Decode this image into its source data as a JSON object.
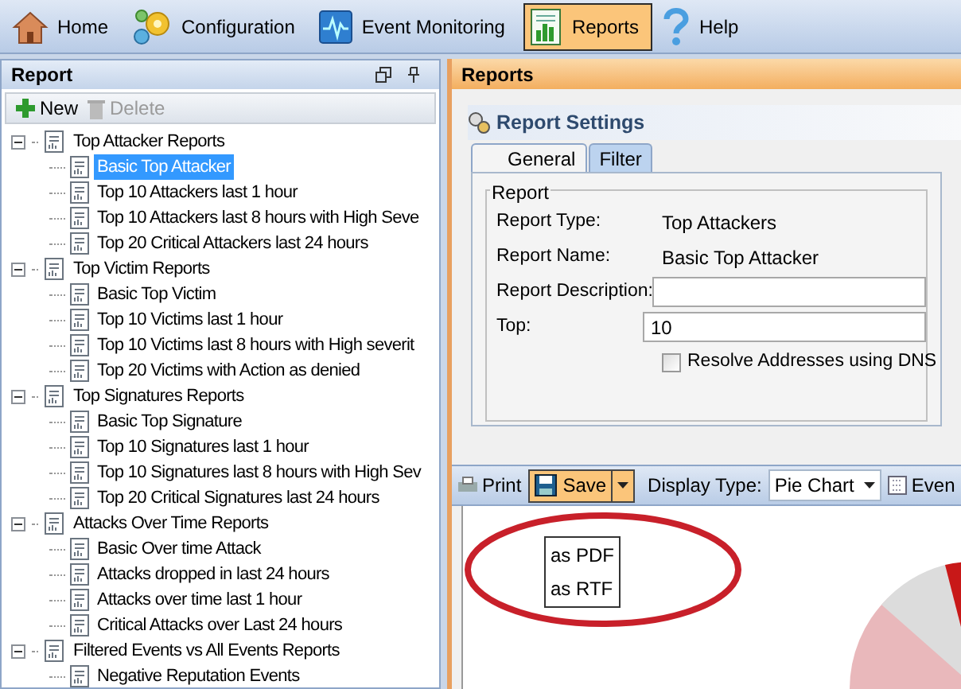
{
  "toolbar": [
    {
      "label": "Home",
      "kind": "house",
      "selected": false
    },
    {
      "label": "Configuration",
      "kind": "gears",
      "selected": false
    },
    {
      "label": "Event Monitoring",
      "kind": "monitor",
      "selected": false
    },
    {
      "label": "Reports",
      "kind": "report",
      "selected": true
    },
    {
      "label": "Help",
      "kind": "help",
      "selected": false
    }
  ],
  "left_panel": {
    "title": "Report",
    "actions": [
      {
        "label": "New",
        "kind": "plus",
        "disabled": false
      },
      {
        "label": "Delete",
        "kind": "trash",
        "disabled": true
      }
    ],
    "tree": [
      {
        "label": "Top Attacker Reports",
        "expanded": true,
        "children": [
          {
            "label": "Basic Top Attacker",
            "selected": true
          },
          {
            "label": "Top 10 Attackers last 1 hour",
            "selected": false
          },
          {
            "label": "Top 10 Attackers last 8 hours with High Seve",
            "selected": false
          },
          {
            "label": "Top 20 Critical Attackers last 24 hours",
            "selected": false
          }
        ]
      },
      {
        "label": "Top Victim Reports",
        "expanded": true,
        "children": [
          {
            "label": "Basic Top Victim",
            "selected": false
          },
          {
            "label": "Top 10 Victims last 1 hour",
            "selected": false
          },
          {
            "label": "Top 10 Victims last 8 hours with High severit",
            "selected": false
          },
          {
            "label": "Top 20 Victims with Action as denied",
            "selected": false
          }
        ]
      },
      {
        "label": "Top Signatures Reports",
        "expanded": true,
        "children": [
          {
            "label": "Basic Top Signature",
            "selected": false
          },
          {
            "label": "Top 10 Signatures last 1 hour",
            "selected": false
          },
          {
            "label": "Top 10 Signatures last 8 hours with High Sev",
            "selected": false
          },
          {
            "label": "Top 20 Critical Signatures last 24 hours",
            "selected": false
          }
        ]
      },
      {
        "label": "Attacks Over Time Reports",
        "expanded": true,
        "children": [
          {
            "label": "Basic Over time Attack",
            "selected": false
          },
          {
            "label": "Attacks dropped in last 24 hours",
            "selected": false
          },
          {
            "label": "Attacks over time last 1 hour",
            "selected": false
          },
          {
            "label": "Critical Attacks over Last 24 hours",
            "selected": false
          }
        ]
      },
      {
        "label": "Filtered Events vs All Events Reports",
        "expanded": true,
        "children": [
          {
            "label": "Negative Reputation Events",
            "selected": false
          }
        ]
      }
    ]
  },
  "right_panel": {
    "title": "Reports",
    "settings_title": "Report Settings",
    "tabs": [
      {
        "label": "General",
        "selected": true
      },
      {
        "label": "Filter",
        "selected": false
      }
    ],
    "group_title": "Report",
    "fields": [
      {
        "kind": "static",
        "label": "Report Type:",
        "value": "Top Attackers"
      },
      {
        "kind": "static",
        "label": "Report Name:",
        "value": "Basic Top Attacker"
      },
      {
        "kind": "input",
        "label": "Report Description:"
      },
      {
        "kind": "input",
        "label": "Top:",
        "value": "10"
      }
    ],
    "checkbox": {
      "label": "Resolve Addresses using DNS",
      "checked": false
    },
    "report_toolbar": {
      "print": "Print",
      "save": "Save",
      "display_type_label": "Display Type:",
      "display_type": "Pie Chart",
      "events": "Even"
    },
    "save_menu": [
      "as PDF",
      "as RTF"
    ]
  }
}
